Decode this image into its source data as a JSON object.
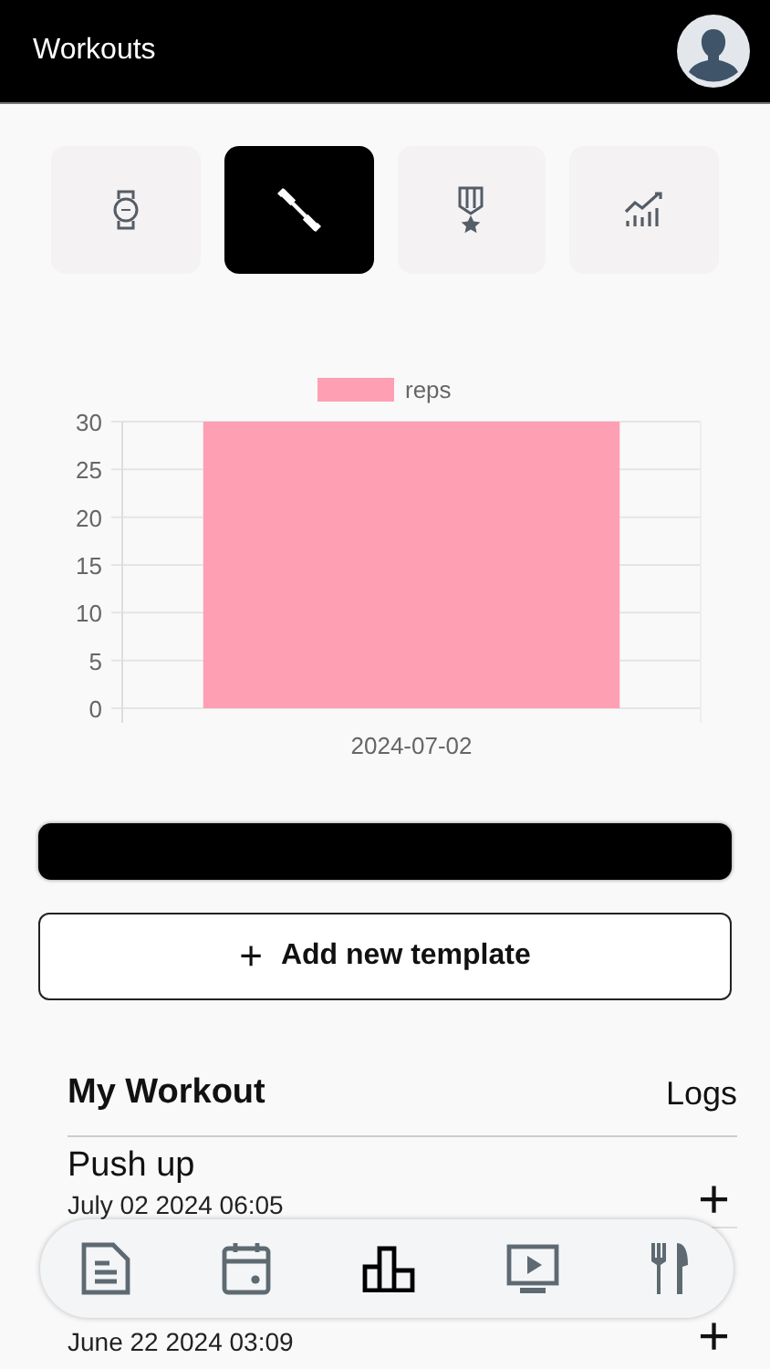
{
  "header": {
    "title": "Workouts"
  },
  "tabs": [
    {
      "selected": false
    },
    {
      "selected": true
    },
    {
      "selected": false
    },
    {
      "selected": false
    }
  ],
  "chart_data": {
    "type": "bar",
    "categories": [
      "2024-07-02"
    ],
    "series": [
      {
        "name": "reps",
        "color": "#ff9fb3",
        "values": [
          30
        ]
      }
    ],
    "ylim": [
      0,
      30
    ],
    "yticks": [
      0,
      5,
      10,
      15,
      20,
      25,
      30
    ],
    "grid": true
  },
  "add_button": {
    "label": "Add new template",
    "icon": "+"
  },
  "section": {
    "title": "My Workout",
    "link": "Logs"
  },
  "logs": [
    {
      "name": "Push up",
      "date": "July 02 2024 06:05",
      "action": "+"
    },
    {
      "date": "June 22 2024 03:09",
      "action": "+"
    }
  ],
  "nav": [
    {
      "selected": false
    },
    {
      "selected": false
    },
    {
      "selected": true
    },
    {
      "selected": false
    },
    {
      "selected": false
    }
  ]
}
